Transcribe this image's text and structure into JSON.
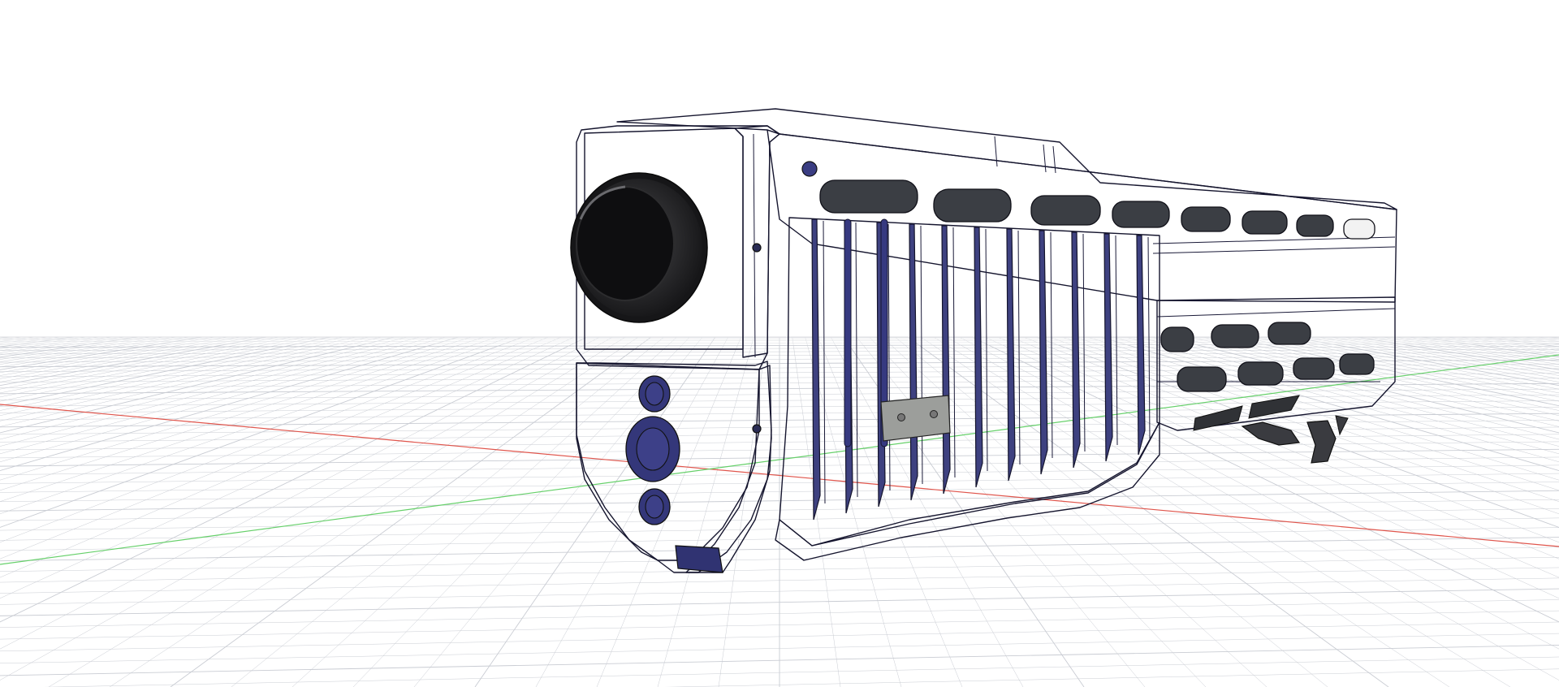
{
  "viewport": {
    "background": "#ffffff",
    "grid_color": "#c9ccd3",
    "x_axis_color": "#e0554c",
    "y_axis_color": "#66d06a"
  },
  "model": {
    "body_color": "#3c3f85",
    "body_light": "#4a4e9a",
    "body_dark": "#2c2f66",
    "edge_color": "#15152e",
    "muzzle_color": "#1c1c1e",
    "plate_color": "#9c9e9b"
  }
}
